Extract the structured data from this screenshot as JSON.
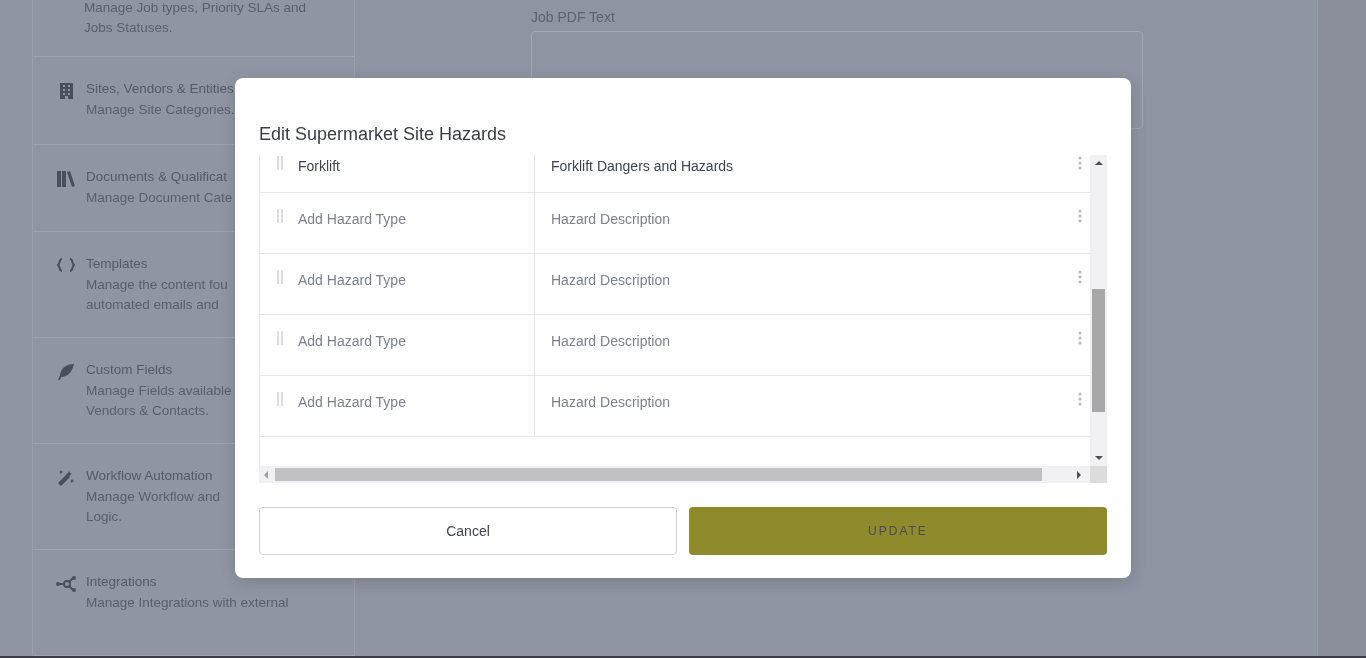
{
  "sidebar": {
    "items": [
      {
        "description": [
          "Manage Job types, Priority SLAs and",
          "Jobs Statuses."
        ]
      },
      {
        "title": "Sites, Vendors & Entities",
        "description": [
          "Manage Site Categories."
        ]
      },
      {
        "title": "Documents & Qualificat",
        "description": [
          "Manage Document Cate"
        ]
      },
      {
        "title": "Templates",
        "description": [
          "Manage the content fou",
          "automated emails and"
        ]
      },
      {
        "title": "Custom Fields",
        "description": [
          "Manage Fields available",
          "Vendors & Contacts."
        ]
      },
      {
        "title": "Workflow Automation",
        "description": [
          "Manage Workflow and",
          "Logic."
        ]
      },
      {
        "title": "Integrations",
        "description": [
          "Manage Integrations with external"
        ]
      }
    ]
  },
  "main": {
    "field_label": "Job PDF Text"
  },
  "dialog": {
    "title": "Edit Supermarket Site Hazards",
    "rows": [
      {
        "hazard_type": {
          "value": "Forklift"
        },
        "description": {
          "value": "Forklift Dangers and Hazards"
        }
      },
      {
        "hazard_type": {
          "placeholder": "Add Hazard Type"
        },
        "description": {
          "placeholder": "Hazard Description"
        }
      },
      {
        "hazard_type": {
          "placeholder": "Add Hazard Type"
        },
        "description": {
          "placeholder": "Hazard Description"
        }
      },
      {
        "hazard_type": {
          "placeholder": "Add Hazard Type"
        },
        "description": {
          "placeholder": "Hazard Description"
        }
      },
      {
        "hazard_type": {
          "placeholder": "Add Hazard Type"
        },
        "description": {
          "placeholder": "Hazard Description"
        }
      }
    ],
    "buttons": [
      {
        "label": "Cancel",
        "kind": "secondary"
      },
      {
        "label": "UPDATE",
        "kind": "primary"
      }
    ]
  }
}
